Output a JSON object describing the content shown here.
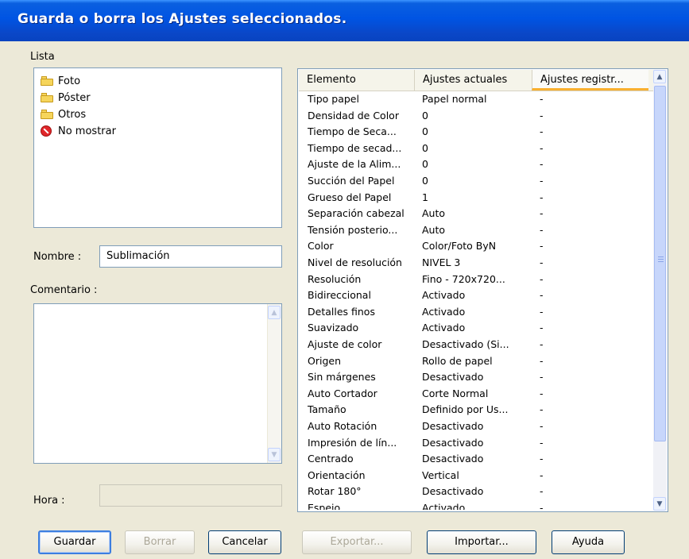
{
  "window": {
    "title": "Guarda o borra los Ajustes seleccionados."
  },
  "list_section": {
    "label": "Lista",
    "items": [
      {
        "label": "Foto",
        "icon": "folder-icon"
      },
      {
        "label": "Póster",
        "icon": "folder-icon"
      },
      {
        "label": "Otros",
        "icon": "folder-icon"
      },
      {
        "label": "No mostrar",
        "icon": "no-entry-icon"
      }
    ]
  },
  "name_field": {
    "label": "Nombre :",
    "value": "Sublimación"
  },
  "comment_field": {
    "label": "Comentario :",
    "value": ""
  },
  "time_field": {
    "label": "Hora :",
    "value": ""
  },
  "settings_table": {
    "columns": [
      "Elemento",
      "Ajustes actuales",
      "Ajustes registr..."
    ],
    "rows": [
      [
        "Tipo papel",
        "Papel normal",
        "-"
      ],
      [
        "Densidad de Color",
        "0",
        "-"
      ],
      [
        "Tiempo de Seca...",
        "0",
        "-"
      ],
      [
        "Tiempo de secad...",
        "0",
        "-"
      ],
      [
        "Ajuste de la Alim...",
        "0",
        "-"
      ],
      [
        "Succión del Papel",
        "0",
        "-"
      ],
      [
        "Grueso del Papel",
        "1",
        "-"
      ],
      [
        "Separación cabezal",
        "Auto",
        "-"
      ],
      [
        "Tensión posterio...",
        "Auto",
        "-"
      ],
      [
        "Color",
        "Color/Foto ByN",
        "-"
      ],
      [
        "Nivel de resolución",
        "NIVEL 3",
        "-"
      ],
      [
        "Resolución",
        "Fino - 720x720...",
        "-"
      ],
      [
        "Bidireccional",
        "Activado",
        "-"
      ],
      [
        "Detalles finos",
        "Activado",
        "-"
      ],
      [
        "Suavizado",
        "Activado",
        "-"
      ],
      [
        "Ajuste de color",
        "Desactivado (Si...",
        "-"
      ],
      [
        "Origen",
        "Rollo de papel",
        "-"
      ],
      [
        "Sin márgenes",
        "Desactivado",
        "-"
      ],
      [
        "Auto Cortador",
        "Corte Normal",
        "-"
      ],
      [
        "Tamaño",
        "Definido por Us...",
        "-"
      ],
      [
        "Auto Rotación",
        "Desactivado",
        "-"
      ],
      [
        "Impresión de lín...",
        "Desactivado",
        "-"
      ],
      [
        "Centrado",
        "Desactivado",
        "-"
      ],
      [
        "Orientación",
        "Vertical",
        "-"
      ],
      [
        "Rotar 180°",
        "Desactivado",
        "-"
      ],
      [
        "Espejo",
        "Activado",
        "-"
      ]
    ]
  },
  "buttons": {
    "save": "Guardar",
    "delete": "Borrar",
    "cancel": "Cancelar",
    "export": "Exportar...",
    "import": "Importar...",
    "help": "Ayuda"
  },
  "colors": {
    "title_bar": "#0054e3",
    "dialog_bg": "#ece9d8",
    "header_hot": "#f9b030"
  }
}
